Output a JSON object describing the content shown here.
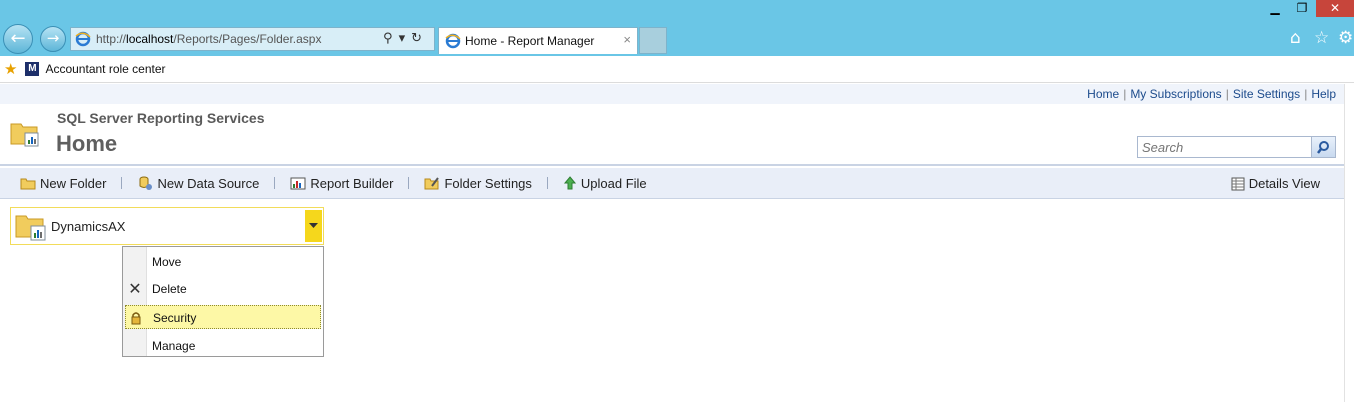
{
  "browser": {
    "address": {
      "scheme": "http://",
      "host": "localhost",
      "path": "/Reports/Pages/Folder.aspx"
    },
    "tab_title": "Home - Report Manager",
    "tab_close": "×",
    "window_controls": {
      "minimize": "▁",
      "restore": "❐",
      "close": "✕"
    },
    "favorites": [
      {
        "label": "Accountant role center",
        "icon": "dynamics-logo-icon"
      }
    ]
  },
  "report_manager": {
    "top_links": [
      "Home",
      "My Subscriptions",
      "Site Settings",
      "Help"
    ],
    "separator": "|",
    "app_name": "SQL Server Reporting Services",
    "page_title": "Home",
    "search_placeholder": "Search",
    "toolbar": {
      "items": [
        {
          "label": "New Folder",
          "icon": "new-folder-icon"
        },
        {
          "label": "New Data Source",
          "icon": "new-data-source-icon"
        },
        {
          "label": "Report Builder",
          "icon": "report-builder-icon"
        },
        {
          "label": "Folder Settings",
          "icon": "folder-settings-icon"
        },
        {
          "label": "Upload File",
          "icon": "upload-icon"
        }
      ],
      "details_view": "Details View"
    },
    "folder_item": {
      "name": "DynamicsAX"
    },
    "context_menu": [
      {
        "label": "Move",
        "icon": ""
      },
      {
        "label": "Delete",
        "icon": "close-icon"
      },
      {
        "label": "Security",
        "icon": "lock-icon",
        "highlighted": true
      },
      {
        "label": "Manage",
        "icon": ""
      }
    ]
  },
  "colors": {
    "chrome": "#6ac6e6",
    "toolbar": "#e9eef8",
    "highlight": "#fdf8a6",
    "accent_yellow": "#f5d71c",
    "link": "#1c4b8c"
  }
}
